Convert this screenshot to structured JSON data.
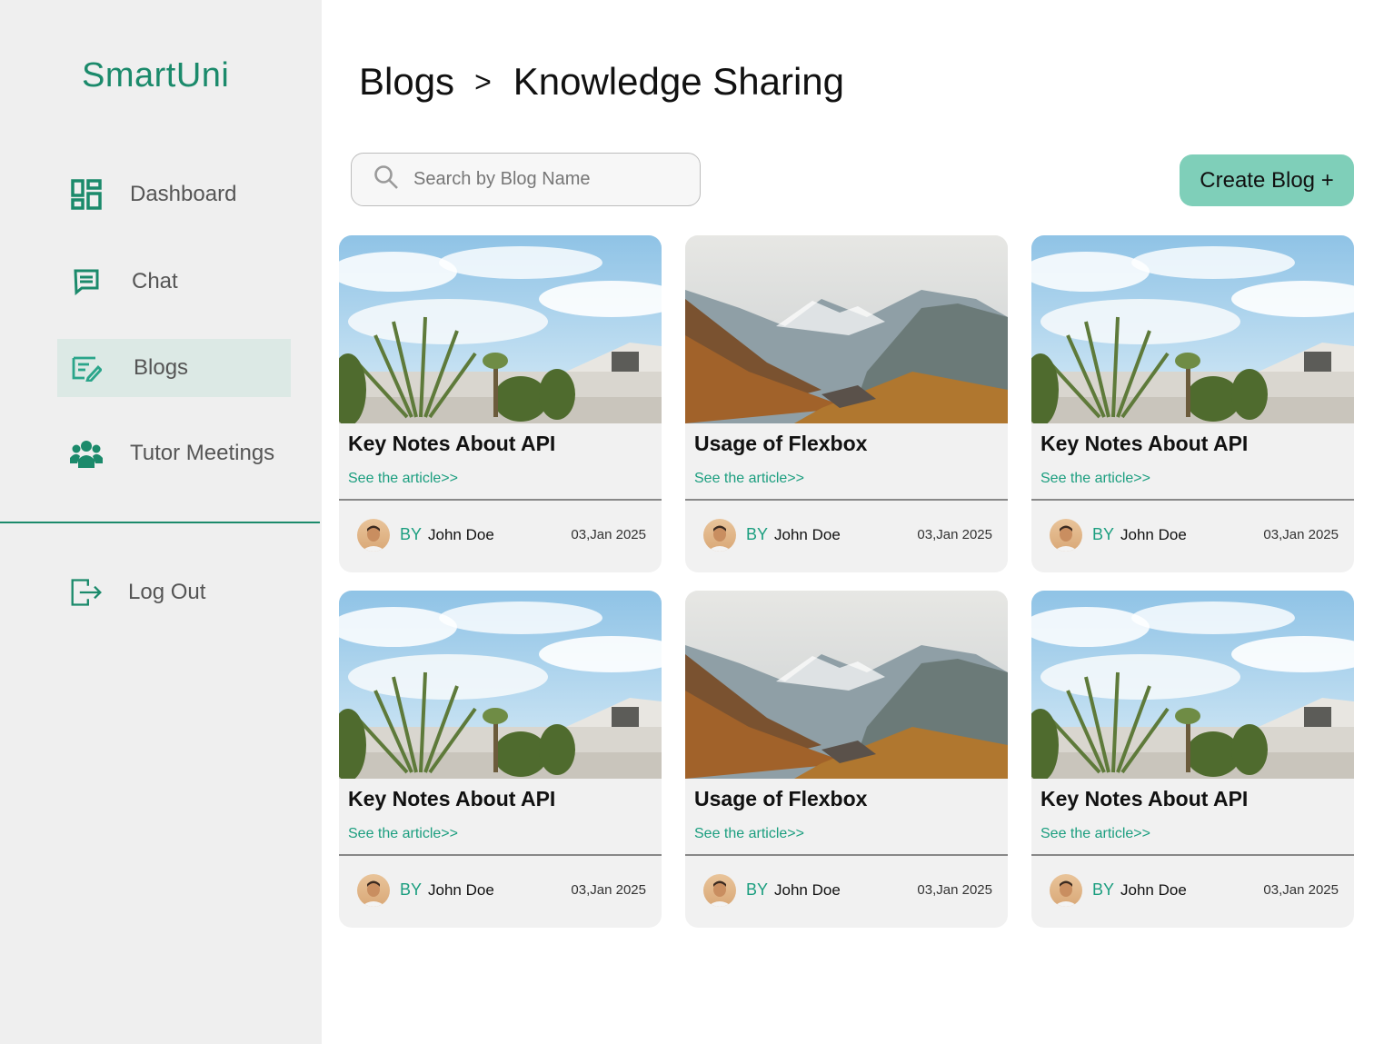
{
  "app": {
    "name": "SmartUni"
  },
  "colors": {
    "accent": "#1b8a6b",
    "button": "#7fcfb9",
    "sidebar_bg": "#efefef",
    "active_bg": "#dce9e5"
  },
  "sidebar": {
    "items": [
      {
        "label": "Dashboard",
        "icon": "dashboard-icon"
      },
      {
        "label": "Chat",
        "icon": "chat-icon"
      },
      {
        "label": "Blogs",
        "icon": "blogs-icon",
        "active": true
      },
      {
        "label": "Tutor Meetings",
        "icon": "people-icon"
      }
    ],
    "logout": {
      "label": "Log Out",
      "icon": "logout-icon"
    }
  },
  "breadcrumb": {
    "parent": "Blogs",
    "separator": ">",
    "current": "Knowledge Sharing"
  },
  "search": {
    "placeholder": "Search by Blog Name",
    "value": ""
  },
  "create_button": {
    "label": "Create Blog +"
  },
  "cards": [
    {
      "title": "Key Notes About API",
      "link": "See the article>>",
      "by": "BY",
      "author": "John Doe",
      "date": "03,Jan 2025",
      "image": "house-plants"
    },
    {
      "title": "Usage of Flexbox",
      "link": "See the article>>",
      "by": "BY",
      "author": "John Doe",
      "date": "03,Jan 2025",
      "image": "mountains"
    },
    {
      "title": "Key Notes About API",
      "link": "See the article>>",
      "by": "BY",
      "author": "John Doe",
      "date": "03,Jan 2025",
      "image": "house-plants"
    },
    {
      "title": "Key Notes About API",
      "link": "See the article>>",
      "by": "BY",
      "author": "John Doe",
      "date": "03,Jan 2025",
      "image": "house-plants"
    },
    {
      "title": "Usage of Flexbox",
      "link": "See the article>>",
      "by": "BY",
      "author": "John Doe",
      "date": "03,Jan 2025",
      "image": "mountains"
    },
    {
      "title": "Key Notes About API",
      "link": "See the article>>",
      "by": "BY",
      "author": "John Doe",
      "date": "03,Jan 2025",
      "image": "house-plants"
    }
  ]
}
